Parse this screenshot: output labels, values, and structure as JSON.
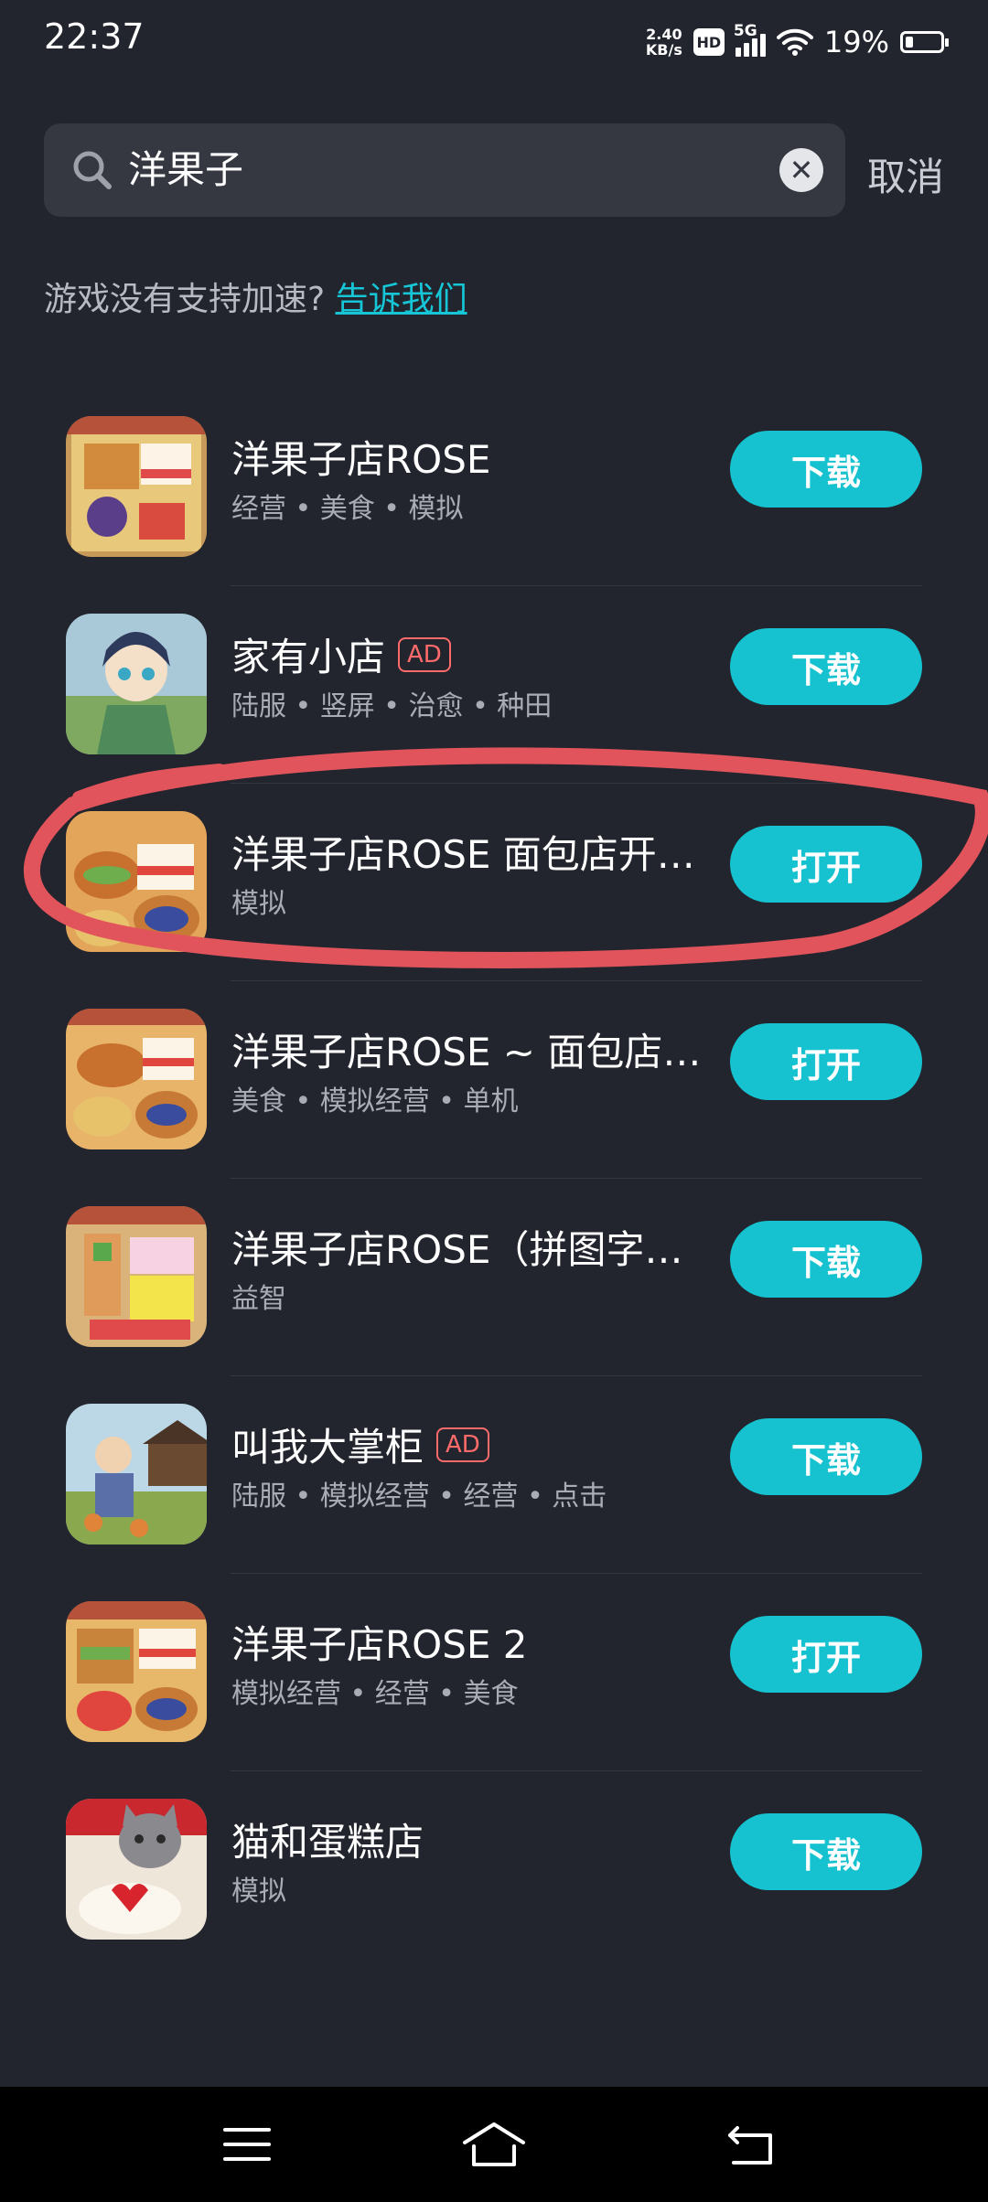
{
  "status_bar": {
    "time": "22:37",
    "net_speed_value": "2.40",
    "net_speed_unit": "KB/s",
    "hd_label": "HD",
    "network_label": "5G",
    "battery_percent": "19%",
    "battery_level": 0.19
  },
  "search": {
    "query": "洋果子",
    "clear_icon": "close-icon",
    "cancel_label": "取消"
  },
  "hint": {
    "text": "游戏没有支持加速?",
    "link": "告诉我们"
  },
  "results": [
    {
      "title": "洋果子店ROSE",
      "ad": "",
      "tags": "经营 • 美食 • 模拟",
      "button": "下载"
    },
    {
      "title": "家有小店",
      "ad": "AD",
      "tags": "陆服 • 竖屏 • 治愈 • 种田",
      "button": "下载"
    },
    {
      "title": "洋果子店ROSE 面包店开…",
      "ad": "",
      "tags": "模拟",
      "button": "打开"
    },
    {
      "title": "洋果子店ROSE ~ 面包店…",
      "ad": "",
      "tags": "美食 • 模拟经营 • 单机",
      "button": "打开"
    },
    {
      "title": "洋果子店ROSE（拼图字…",
      "ad": "",
      "tags": "益智",
      "button": "下载"
    },
    {
      "title": "叫我大掌柜",
      "ad": "AD",
      "tags": "陆服 • 模拟经营 • 经营 • 点击",
      "button": "下载"
    },
    {
      "title": "洋果子店ROSE 2",
      "ad": "",
      "tags": "模拟经营 • 经营 • 美食",
      "button": "打开"
    },
    {
      "title": "猫和蛋糕店",
      "ad": "",
      "tags": "模拟",
      "button": "下载"
    }
  ],
  "colors": {
    "background": "#22252d",
    "accent": "#16c2cf",
    "annotation": "#e2545c"
  },
  "nav_bar": {
    "icons": [
      "menu-icon",
      "home-icon",
      "back-icon"
    ]
  }
}
